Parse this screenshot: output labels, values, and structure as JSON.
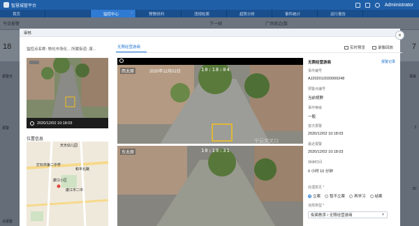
{
  "app": {
    "title": "智慧城管平台",
    "user": "Administrator"
  },
  "tabs": [
    {
      "label": "首页"
    },
    {
      "label": "监控中心"
    },
    {
      "label": "预警研判"
    },
    {
      "label": "违规检索"
    },
    {
      "label": "趋势分析"
    },
    {
      "label": "事件统计"
    },
    {
      "label": "运行报告"
    }
  ],
  "background": {
    "strip_left": "今日报警",
    "strip_mid": "下一帧",
    "strip_right": "广场周边(数",
    "card_left_value": "18",
    "card_right_value": "7",
    "side_labels": [
      "报警无",
      "报警",
      "点报警"
    ],
    "side_right_labels": [
      "事故",
      "3",
      "30"
    ]
  },
  "modal": {
    "title": "审核",
    "close_glyph": "×",
    "camera_label": "监控点名称:",
    "camera_name": "物化市场化... 所属街道: 康...",
    "thumb_time": "2020/12/02 10:18:03",
    "location_title": "位置信息",
    "map_places": [
      "天天幼儿园",
      "打石市第二中学",
      "和平北路",
      "康江小区",
      "康江市二中"
    ],
    "video_tab": "无照经营游商",
    "tool_preview": "实时预览",
    "tool_record": "录像回放",
    "frames": [
      {
        "label": "西太原",
        "time": "10:18:04",
        "watermark": "宁云交叉口"
      },
      {
        "label": "东太原",
        "time": "10:19:31",
        "watermark": ""
      }
    ],
    "frame_date": "2020年12月02日",
    "panel": {
      "title": "无照经营游商",
      "link": "报警记录",
      "fields": [
        {
          "label": "事件编号",
          "value": "AJ202012020000248"
        },
        {
          "label": "预警点编号",
          "value": "当前视野"
        },
        {
          "label": "事件等级",
          "value": "一般"
        },
        {
          "label": "首次报警",
          "value": "2020/12/02 10:18:03"
        },
        {
          "label": "最近报警",
          "value": "2020/12/02 10:18:03"
        },
        {
          "label": "持续时间",
          "value": "0 小时 10 分钟"
        }
      ],
      "result_label": "处理意见 *",
      "radios": [
        {
          "label": "立案",
          "checked": true
        },
        {
          "label": "暂不立案",
          "checked": false
        },
        {
          "label": "再学习",
          "checked": false
        },
        {
          "label": "结案",
          "checked": false
        }
      ],
      "type_label": "违规类型 *",
      "type_value": "街面秩序 / 无照经营游商"
    }
  }
}
